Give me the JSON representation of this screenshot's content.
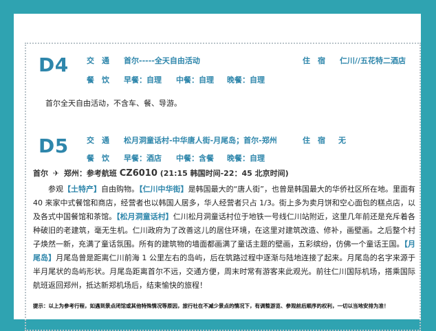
{
  "d4": {
    "code": "D4",
    "transport_label": "交　通",
    "transport_value": "首尔-----全天自由活动",
    "stay_label": "住　宿",
    "stay_value": "仁川//五花特二酒店",
    "meal_label": "餐　饮",
    "breakfast": "早餐：自理",
    "lunch": "中餐：自理",
    "dinner": "晚餐：自理",
    "note": "首尔全天自由活动，不含车、餐、导游。"
  },
  "d5": {
    "code": "D5",
    "transport_label": "交　通",
    "transport_value": "松月洞童话村-中华唐人街-月尾岛；首尔-郑州",
    "stay_label": "住　宿",
    "stay_value": "无",
    "meal_label": "餐　饮",
    "breakfast": "早餐：酒店",
    "lunch": "中餐：含餐",
    "dinner": "晚餐：自理",
    "flight_from": "首尔",
    "flight_to": "郑州：参考航班",
    "flight_code": "CZ6010",
    "flight_time": "(21:15 韩国时间-22：45 北京时间)",
    "paragraph": [
      {
        "t": "参观",
        "h": false
      },
      {
        "t": "【土特产】",
        "h": true
      },
      {
        "t": "自由购物。",
        "h": false
      },
      {
        "t": "【仁川中华街】",
        "h": true
      },
      {
        "t": "是韩国最大的“唐人街”，也曾是韩国最大的华侨社区所在地。里面有 40 来家中式餐馆和商店，经营者也以韩国人居多，华人经营者只占 1/3。街上多为卖月饼和空心面包的糕点店，以及各式中国餐馆和茶馆。",
        "h": false
      },
      {
        "t": "【松月洞童话村】",
        "h": true
      },
      {
        "t": "仁川松月洞童话村位于地铁一号线仁川站附近，这里几年前还是充斥着各种破旧的老建筑，毫无生机。仁川政府为了改善这儿的居住环境，在这里对建筑改造、修补，画壁画。之后整个村子焕然一新，充满了童话氛围。所有的建筑物的墙面都画满了童话主题的壁画，五彩缤纷，仿佛一个童话王国。",
        "h": false
      },
      {
        "t": "【月尾岛】",
        "h": true
      },
      {
        "t": "月尾岛曾是距离仁川前海 1 公里左右的岛屿，后在筑路过程中逐渐与陆地连接了起来。月尾岛的名字来源于半月尾状的岛屿形状。月尾岛距离首尔不远，交通方便，周末时常有游客来此观光。前往仁川国际机场，搭乘国际航班返回郑州，抵达新郑机场后，结束愉快的旅程！",
        "h": false
      }
    ]
  },
  "tip": "提示：以上为参考行程，如遇到景点闭馆或其他特殊情况等原因，旅行社在不减少景点的情况下，有调整游览、参观前后顺序的权利，一切以当地安排为准！",
  "colors": {
    "accent": "#2e86ab",
    "background": "#2fa3b1"
  }
}
